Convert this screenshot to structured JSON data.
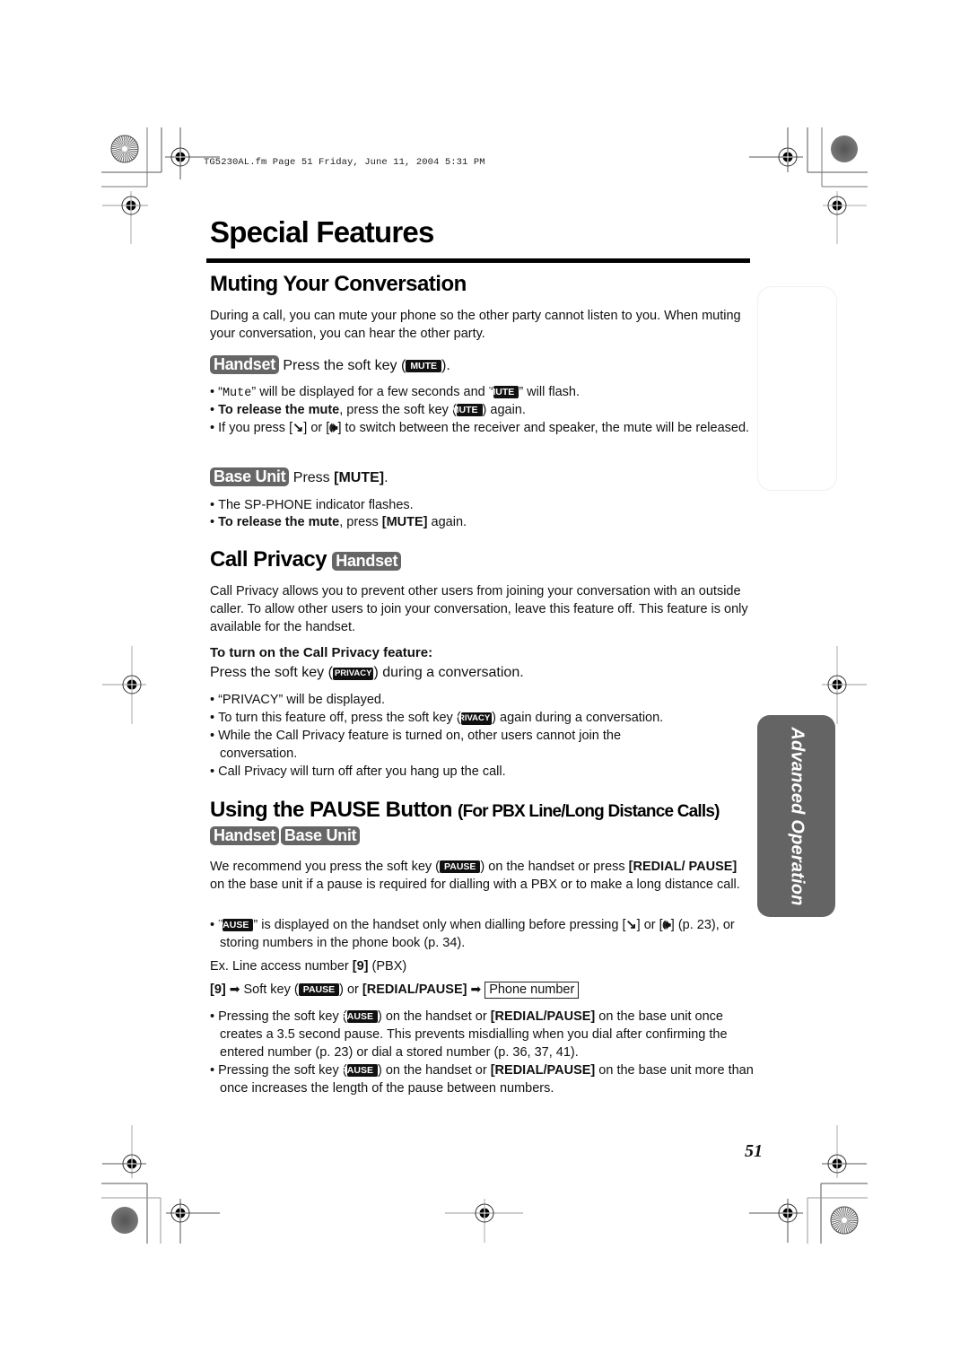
{
  "print_header": "TG5230AL.fm  Page 51  Friday, June 11, 2004  5:31 PM",
  "page_title": "Special Features",
  "sections": {
    "muting": {
      "heading": "Muting Your Conversation",
      "intro": "During a call, you can mute your phone so the other party cannot listen to you. When muting your conversation, you can hear the other party.",
      "handset": {
        "badge": "Handset",
        "instruction_pre": "Press the soft key (",
        "key": "MUTE",
        "instruction_post": ").",
        "bullets": [
          {
            "pre": "“",
            "mono": "Mute",
            "mid": "” will be displayed for a few seconds and “",
            "key": "MUTE",
            "post": "” will flash."
          },
          {
            "bold": "To release the mute",
            "mid": ", press the soft key (",
            "key": "MUTE",
            "post": ") again."
          },
          {
            "pre": "If you press [",
            "icon1": "talk-icon",
            "mid": "] or [",
            "icon2": "speaker-icon",
            "post": "] to switch between the receiver and speaker, the mute will be released."
          }
        ]
      },
      "base_unit": {
        "badge": "Base Unit",
        "instruction_pre": "Press ",
        "instruction_bold": "[MUTE]",
        "instruction_post": ".",
        "bullets": [
          {
            "text": "The SP-PHONE indicator flashes."
          },
          {
            "bold": "To release the mute",
            "mid": ", press ",
            "bold2": "[MUTE]",
            "post": " again."
          }
        ]
      }
    },
    "call_privacy": {
      "heading": "Call Privacy",
      "badge": "Handset",
      "intro": "Call Privacy allows you to prevent other users from joining your conversation with an outside caller. To allow other users to join your conversation, leave this feature off. This feature is only available for the handset.",
      "subheading": "To turn on the Call Privacy feature:",
      "instruction_pre": "Press the soft key (",
      "key": "PRIVACY",
      "instruction_post": ") during a conversation.",
      "bullets": [
        {
          "text": "“PRIVACY” will be displayed."
        },
        {
          "pre": "To turn this feature off, press the soft key (",
          "key": "PRIVACY",
          "post": ") again during a conversation."
        },
        {
          "text": "While the Call Privacy feature is turned on, other users cannot join the conversation."
        },
        {
          "text": "Call Privacy will turn off after you hang up the call."
        }
      ]
    },
    "pause": {
      "heading_main": "Using the PAUSE Button",
      "heading_sub": "(For PBX Line/Long Distance Calls)",
      "badges": [
        "Handset",
        "Base Unit"
      ],
      "intro_pre": "We recommend you press the soft key (",
      "intro_key": "PAUSE",
      "intro_mid": ") on the handset or press ",
      "intro_bold": "[REDIAL/ PAUSE]",
      "intro_post": " on the base unit if a pause is required for dialling with a PBX or to make a long distance call.",
      "bullet_display": {
        "pre": "“",
        "key": "PAUSE",
        "mid": "” is displayed on the handset only when dialling before pressing [",
        "icon1": "talk-icon",
        "mid2": "] or [",
        "icon2": "speaker-icon",
        "post": "] (p. 23), or storing numbers in the phone book (p. 34)."
      },
      "example_pre": "Ex. Line access number ",
      "example_bold": "[9]",
      "example_post": " (PBX)",
      "sequence": {
        "step1": "[9]",
        "step2_pre": "Soft key (",
        "step2_key": "PAUSE",
        "step2_mid": ") or ",
        "step2_bold": "[REDIAL/PAUSE]",
        "step3": "Phone number"
      },
      "bullets": [
        {
          "pre": "Pressing the soft key (",
          "key": "PAUSE",
          "mid": ") on the handset or ",
          "bold": "[REDIAL/PAUSE]",
          "post": " on the base unit once creates a 3.5 second pause. This prevents misdialling when you dial after confirming the entered number (p. 23) or dial a stored number (p. 36, 37, 41)."
        },
        {
          "pre": "Pressing the soft key (",
          "key": "PAUSE",
          "mid": ") on the handset or ",
          "bold": "[REDIAL/PAUSE]",
          "post": " on the base unit more than once increases the length of the pause between numbers."
        }
      ]
    }
  },
  "side_tab": {
    "label": "Advanced Operation",
    "color": "#646464"
  },
  "page_number": "51"
}
